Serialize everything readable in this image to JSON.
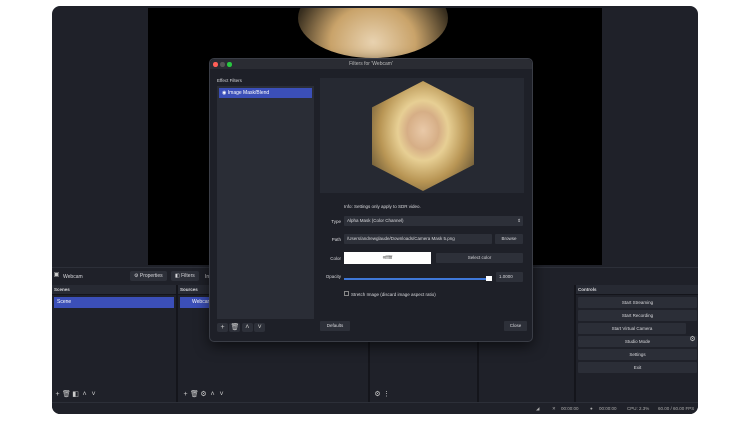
{
  "dialog": {
    "title": "Filters for 'Webcam'",
    "effect_filters_label": "Effect Filters",
    "filters": [
      {
        "label": "Image Mask/Blend",
        "visible": true
      }
    ],
    "info": "Info: Settings only apply to SDR video.",
    "type_label": "Type",
    "type_value": "Alpha Mask (Color Channel)",
    "path_label": "Path",
    "path_value": "/Users/andrewglaude/Downloads/Camera Mask 5.png",
    "browse": "Browse",
    "color_label": "Color",
    "color_value": "#ffffff",
    "select_color": "Select color",
    "opacity_label": "Opacity",
    "opacity_value": "1.0000",
    "opacity_fraction": 1.0,
    "stretch_label": "Stretch Image (discard image aspect ratio)",
    "stretch_checked": false,
    "defaults": "Defaults",
    "close": "Close"
  },
  "toolbar": {
    "source_name": "Webcam",
    "properties": "Properties",
    "filters": "Filters",
    "truncated": "In"
  },
  "scenes": {
    "title": "Scenes",
    "items": [
      "Scene"
    ]
  },
  "sources": {
    "title": "Sources",
    "items": [
      "Webcam"
    ]
  },
  "controls": {
    "title": "Controls",
    "buttons": [
      "Start Streaming",
      "Start Recording",
      "Start Virtual Camera",
      "Studio Mode",
      "Settings",
      "Exit"
    ]
  },
  "status": {
    "rec_time": "00:00:00",
    "stream_time": "00:00:00",
    "cpu": "CPU: 2.3%",
    "fps": "60.00 / 60.00 FPS"
  },
  "colors": {
    "accent": "#3b4fb8",
    "background": "#1f2129"
  }
}
